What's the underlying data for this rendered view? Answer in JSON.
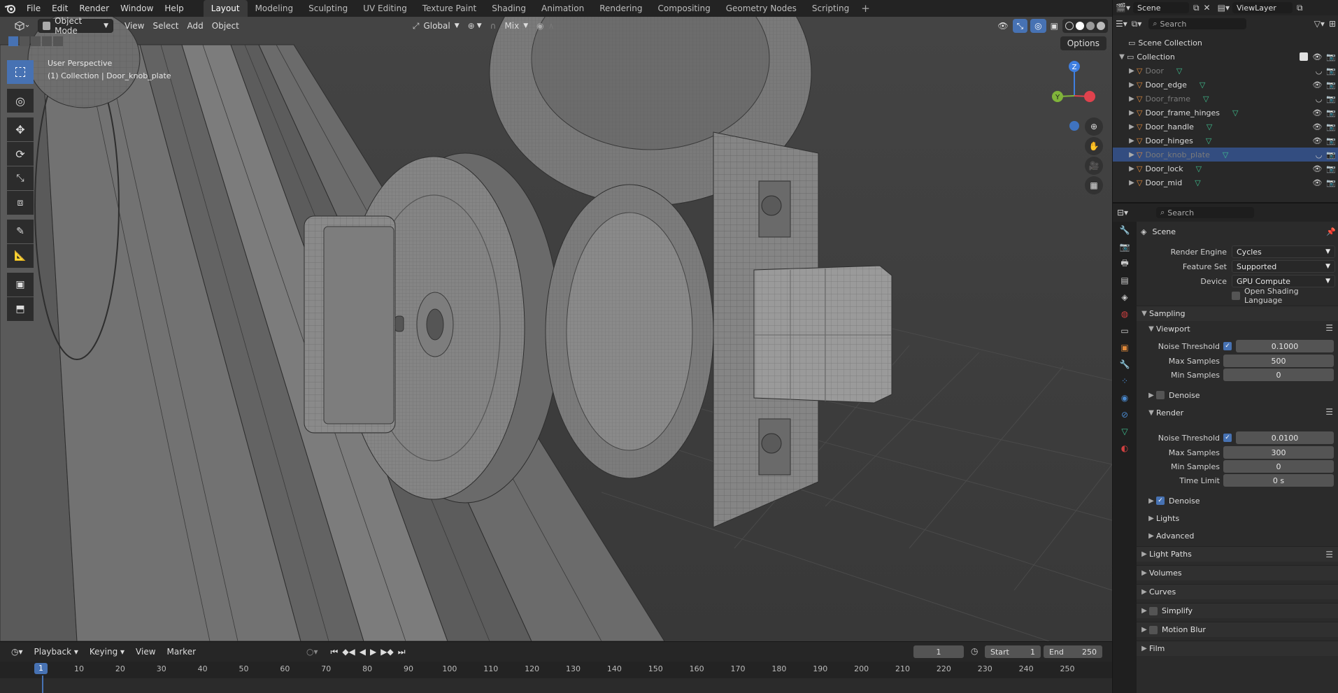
{
  "topbar": {
    "menus": [
      "File",
      "Edit",
      "Render",
      "Window",
      "Help"
    ],
    "workspaces": [
      "Layout",
      "Modeling",
      "Sculpting",
      "UV Editing",
      "Texture Paint",
      "Shading",
      "Animation",
      "Rendering",
      "Compositing",
      "Geometry Nodes",
      "Scripting"
    ],
    "active_workspace": "Layout",
    "add_tab": "+"
  },
  "viewport": {
    "mode": "Object Mode",
    "menus": [
      "View",
      "Select",
      "Add",
      "Object"
    ],
    "transform_orientation": "Global",
    "snap_target": "Mix",
    "options_label": "Options",
    "perspective_label": "User Perspective",
    "context_label": "(1) Collection | Door_knob_plate",
    "gizmo": {
      "x": "",
      "y": "Y",
      "z": "Z"
    }
  },
  "timeline": {
    "menus": [
      "Playback",
      "Keying",
      "View",
      "Marker"
    ],
    "current_frame": "1",
    "start_label": "Start",
    "start_value": "1",
    "end_label": "End",
    "end_value": "250",
    "ruler": [
      "1",
      "10",
      "20",
      "30",
      "40",
      "50",
      "60",
      "70",
      "80",
      "90",
      "100",
      "110",
      "120",
      "130",
      "140",
      "150",
      "160",
      "170",
      "180",
      "190",
      "200",
      "210",
      "220",
      "230",
      "240",
      "250"
    ]
  },
  "outliner": {
    "scene": "Scene",
    "view_layer": "ViewLayer",
    "search_placeholder": "Search",
    "scene_collection": "Scene Collection",
    "collection": "Collection",
    "objects": [
      {
        "name": "Door",
        "dim": true,
        "selected": false
      },
      {
        "name": "Door_edge",
        "dim": false,
        "selected": false
      },
      {
        "name": "Door_frame",
        "dim": true,
        "selected": false
      },
      {
        "name": "Door_frame_hinges",
        "dim": false,
        "selected": false
      },
      {
        "name": "Door_handle",
        "dim": false,
        "selected": false
      },
      {
        "name": "Door_hinges",
        "dim": false,
        "selected": false
      },
      {
        "name": "Door_knob_plate",
        "dim": true,
        "selected": true
      },
      {
        "name": "Door_lock",
        "dim": false,
        "selected": false
      },
      {
        "name": "Door_mid",
        "dim": false,
        "selected": false
      }
    ]
  },
  "properties": {
    "search_placeholder": "Search",
    "context": "Scene",
    "render_engine_label": "Render Engine",
    "render_engine": "Cycles",
    "feature_set_label": "Feature Set",
    "feature_set": "Supported",
    "device_label": "Device",
    "device": "GPU Compute",
    "osl_label": "Open Shading Language",
    "sampling_label": "Sampling",
    "viewport_label": "Viewport",
    "viewport_noise_label": "Noise Threshold",
    "viewport_noise": "0.1000",
    "viewport_max_label": "Max Samples",
    "viewport_max": "500",
    "viewport_min_label": "Min Samples",
    "viewport_min": "0",
    "viewport_denoise_label": "Denoise",
    "render_label": "Render",
    "render_noise_label": "Noise Threshold",
    "render_noise": "0.0100",
    "render_max_label": "Max Samples",
    "render_max": "300",
    "render_min_label": "Min Samples",
    "render_min": "0",
    "time_limit_label": "Time Limit",
    "time_limit": "0 s",
    "render_denoise_label": "Denoise",
    "lights_label": "Lights",
    "advanced_label": "Advanced",
    "light_paths_label": "Light Paths",
    "volumes_label": "Volumes",
    "curves_label": "Curves",
    "simplify_label": "Simplify",
    "motion_blur_label": "Motion Blur",
    "film_label": "Film"
  },
  "colors": {
    "accent": "#4772b3",
    "mesh_object": "#e0893a",
    "mesh_data": "#3fbf8f",
    "axis_x": "#e0424d",
    "axis_y": "#80b43a",
    "axis_z": "#3f7fe0"
  }
}
